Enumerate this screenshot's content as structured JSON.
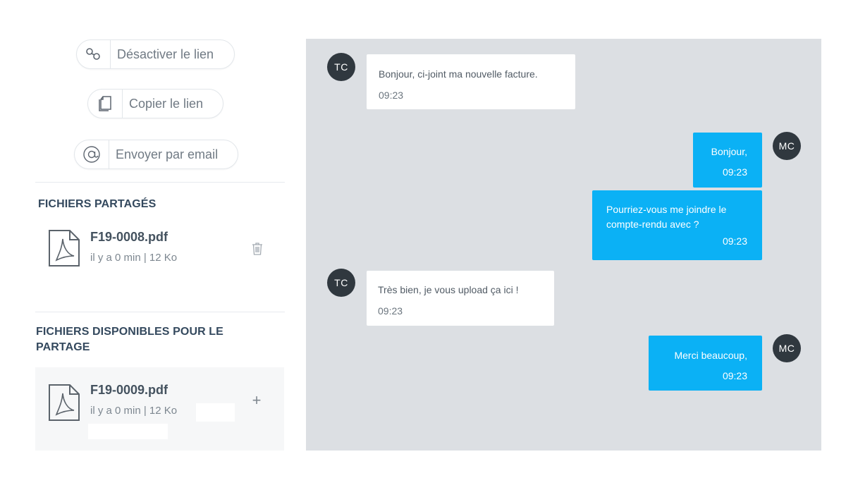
{
  "share_actions": {
    "disable_link": {
      "label": "Désactiver le lien",
      "icon": "link-icon"
    },
    "copy_link": {
      "label": "Copier le lien",
      "icon": "copy-icon"
    },
    "send_email": {
      "label": "Envoyer par email",
      "icon": "at-icon"
    }
  },
  "shared_files": {
    "title": "FICHIERS PARTAGÉS",
    "items": [
      {
        "name": "F19-0008.pdf",
        "meta": "il y a 0 min | 12 Ko",
        "action_icon": "trash-icon"
      }
    ]
  },
  "available_files": {
    "title": "FICHIERS DISPONIBLES POUR LE PARTAGE",
    "items": [
      {
        "name": "F19-0009.pdf",
        "meta": "il y a 0 min | 12 Ko",
        "action_icon": "plus-icon",
        "action_glyph": "+"
      }
    ]
  },
  "chat": {
    "colors": {
      "background": "#dcdfe3",
      "outgoing": "#0bb1f5",
      "incoming": "#ffffff",
      "avatar": "#30383f"
    },
    "messages": [
      {
        "from": "TC",
        "direction": "in",
        "text": "Bonjour, ci-joint ma nouvelle facture.",
        "time": "09:23"
      },
      {
        "from": "MC",
        "direction": "out",
        "text": "Bonjour,",
        "time": "09:23"
      },
      {
        "from": "MC",
        "direction": "out",
        "text_lines": [
          "Pourriez-vous me joindre le",
          "compte-rendu avec ?"
        ],
        "time": "09:23"
      },
      {
        "from": "TC",
        "direction": "in",
        "text": "Très bien, je vous upload ça ici !",
        "time": "09:23"
      },
      {
        "from": "MC",
        "direction": "out",
        "text": "Merci beaucoup,",
        "time": "09:23"
      }
    ]
  }
}
